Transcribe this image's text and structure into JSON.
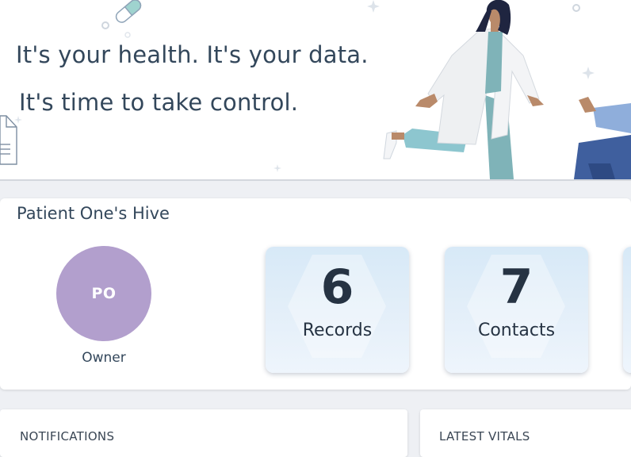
{
  "hero": {
    "line1": "It's your health. It's your data.",
    "line2": "It's time to take control."
  },
  "hive": {
    "title": "Patient One's Hive",
    "avatar_initials": "PO",
    "avatar_color": "#b29fcd",
    "role": "Owner",
    "stats": [
      {
        "value": "6",
        "label": "Records"
      },
      {
        "value": "7",
        "label": "Contacts"
      }
    ]
  },
  "panels": {
    "notifications_title": "NOTIFICATIONS",
    "vitals_title": "LATEST VITALS"
  },
  "colors": {
    "heading": "#33475b",
    "tile_gradient_top": "#d7e9f7",
    "coat": "#eef0f2",
    "scrubs": "#7fb3b8"
  }
}
